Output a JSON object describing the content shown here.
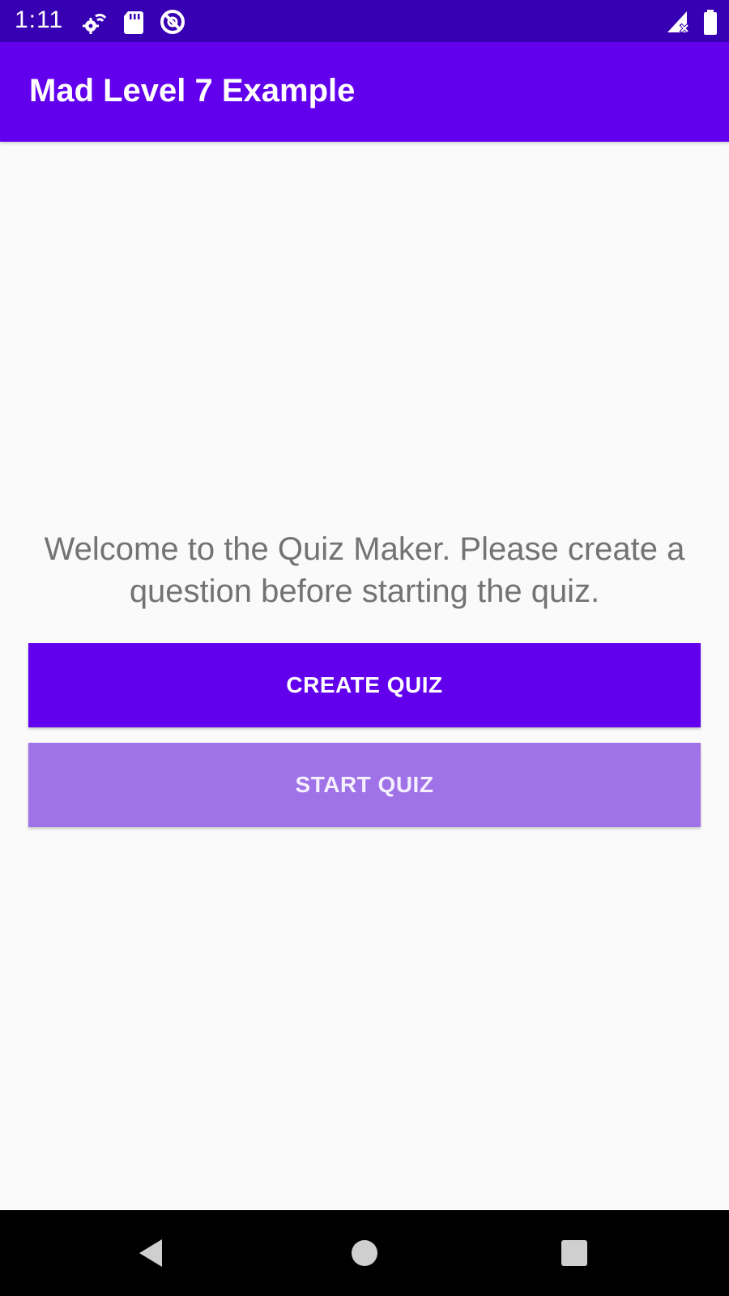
{
  "status_bar": {
    "time": "1:11",
    "icons": [
      "settings-icon",
      "sd-card-icon",
      "no-disturb-icon",
      "signal-icon",
      "battery-icon"
    ]
  },
  "app_bar": {
    "title": "Mad Level 7 Example",
    "color": "#6200ee"
  },
  "main": {
    "welcome_text": "Welcome to the Quiz Maker. Please create a question before starting the quiz.",
    "create_button_label": "CREATE QUIZ",
    "start_button_label": "START QUIZ",
    "start_button_enabled": false
  },
  "nav_bar": {
    "buttons": [
      "back-icon",
      "home-icon",
      "recents-icon"
    ]
  }
}
